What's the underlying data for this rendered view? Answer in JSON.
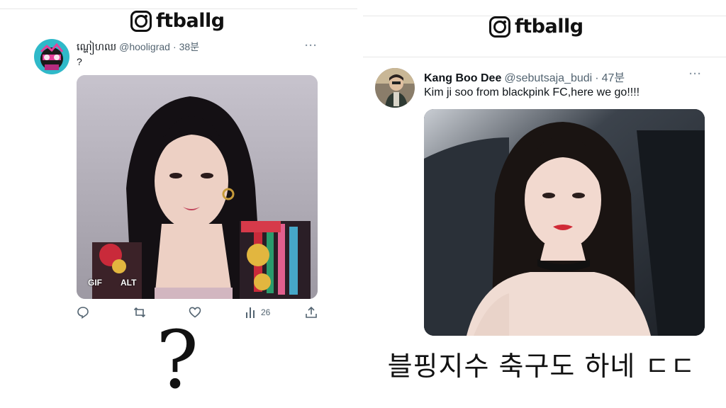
{
  "left": {
    "watermark": {
      "text": "ftballg",
      "icon": "instagram-icon"
    },
    "tweet": {
      "display_name": "ណ្ហៀហឈ",
      "handle": "@hooligrad",
      "dot": "·",
      "time": "38분",
      "text": "?",
      "media_badges": {
        "gif": "GIF",
        "alt": "ALT"
      },
      "actions": {
        "reply_icon": "reply-icon",
        "retweet_icon": "retweet-icon",
        "like_icon": "like-icon",
        "views_icon": "views-icon",
        "views_count": "26",
        "share_icon": "share-icon"
      }
    },
    "caption": "?"
  },
  "right": {
    "watermark": {
      "text": "ftballg",
      "icon": "instagram-icon"
    },
    "tweet": {
      "display_name": "Kang Boo Dee",
      "handle": "@sebutsaja_budi",
      "dot": "·",
      "time": "47분",
      "text": "Kim ji soo from blackpink FC,here we go!!!!"
    },
    "caption": "블핑지수 축구도 하네 ㄷㄷ"
  },
  "colors": {
    "text": "#0f1419",
    "secondary": "#536471",
    "divider": "#e6e6e6"
  }
}
